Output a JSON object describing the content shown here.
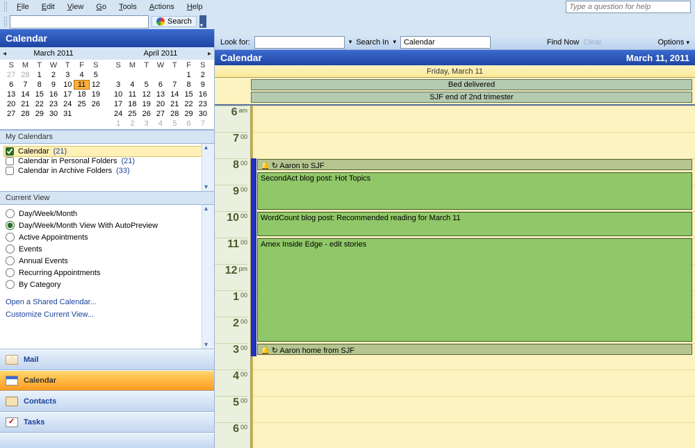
{
  "menus": [
    "File",
    "Edit",
    "View",
    "Go",
    "Tools",
    "Actions",
    "Help"
  ],
  "help_placeholder": "Type a question for help",
  "search_label": "Search",
  "sidebar_title": "Calendar",
  "minicals": [
    {
      "title": "March 2011",
      "has_left_nav": true,
      "lead_dim": [
        27,
        28
      ],
      "days": 31,
      "trail_dim": [],
      "today": 11
    },
    {
      "title": "April 2011",
      "has_right_nav": true,
      "lead_dim": [],
      "days": 30,
      "trail_dim": [
        1,
        2,
        3,
        4,
        5,
        6,
        7
      ],
      "first_dow": 5
    }
  ],
  "dow_letters": [
    "S",
    "M",
    "T",
    "W",
    "T",
    "F",
    "S"
  ],
  "my_calendars_hdr": "My Calendars",
  "calendars": [
    {
      "name": "Calendar",
      "count": "(21)",
      "checked": true,
      "selected": true
    },
    {
      "name": "Calendar in Personal Folders",
      "count": "(21)",
      "checked": false
    },
    {
      "name": "Calendar in Archive Folders",
      "count": "(33)",
      "checked": false
    }
  ],
  "current_view_hdr": "Current View",
  "views": [
    "Day/Week/Month",
    "Day/Week/Month View With AutoPreview",
    "Active Appointments",
    "Events",
    "Annual Events",
    "Recurring Appointments",
    "By Category"
  ],
  "view_selected_index": 1,
  "links": [
    "Open a Shared Calendar...",
    "Customize Current View..."
  ],
  "nav_items": [
    {
      "icon": "mail",
      "label": "Mail"
    },
    {
      "icon": "cal",
      "label": "Calendar",
      "active": true
    },
    {
      "icon": "contacts",
      "label": "Contacts"
    },
    {
      "icon": "tasks",
      "label": "Tasks"
    }
  ],
  "findbar": {
    "look_for": "Look for:",
    "search_in": "Search In",
    "search_in_value": "Calendar",
    "find_now": "Find Now",
    "clear": "Clear",
    "options": "Options"
  },
  "banner": {
    "title": "Calendar",
    "date": "March 11, 2011"
  },
  "day_header": "Friday, March 11",
  "allday_events": [
    "Bed delivered",
    "SJF end of 2nd trimester"
  ],
  "time_slots": [
    {
      "hr": "6",
      "m": "am"
    },
    {
      "hr": "7",
      "m": "00"
    },
    {
      "hr": "8",
      "m": "00"
    },
    {
      "hr": "9",
      "m": "00"
    },
    {
      "hr": "10",
      "m": "00"
    },
    {
      "hr": "11",
      "m": "00"
    },
    {
      "hr": "12",
      "m": "pm"
    },
    {
      "hr": "1",
      "m": "00"
    },
    {
      "hr": "2",
      "m": "00"
    },
    {
      "hr": "3",
      "m": "00"
    },
    {
      "hr": "4",
      "m": "00"
    },
    {
      "hr": "5",
      "m": "00"
    },
    {
      "hr": "6",
      "m": "00"
    }
  ],
  "events": [
    {
      "title": "Aaron to SJF",
      "slot_start": 2,
      "dur_slots": 0.5,
      "stripe": true,
      "icons": true
    },
    {
      "title": "SecondAct blog post: Hot Topics",
      "slot_start": 2.5,
      "dur_slots": 1.5
    },
    {
      "title": "WordCount blog post: Recommended reading for March 11",
      "slot_start": 4,
      "dur_slots": 1
    },
    {
      "title": "Amex Inside Edge - edit stories",
      "slot_start": 5,
      "dur_slots": 4
    },
    {
      "title": "Aaron home from SJF",
      "slot_start": 9,
      "dur_slots": 0.5,
      "stripe": true,
      "icons": true
    }
  ],
  "bluebar": {
    "slot_start": 2,
    "slot_end": 9
  }
}
